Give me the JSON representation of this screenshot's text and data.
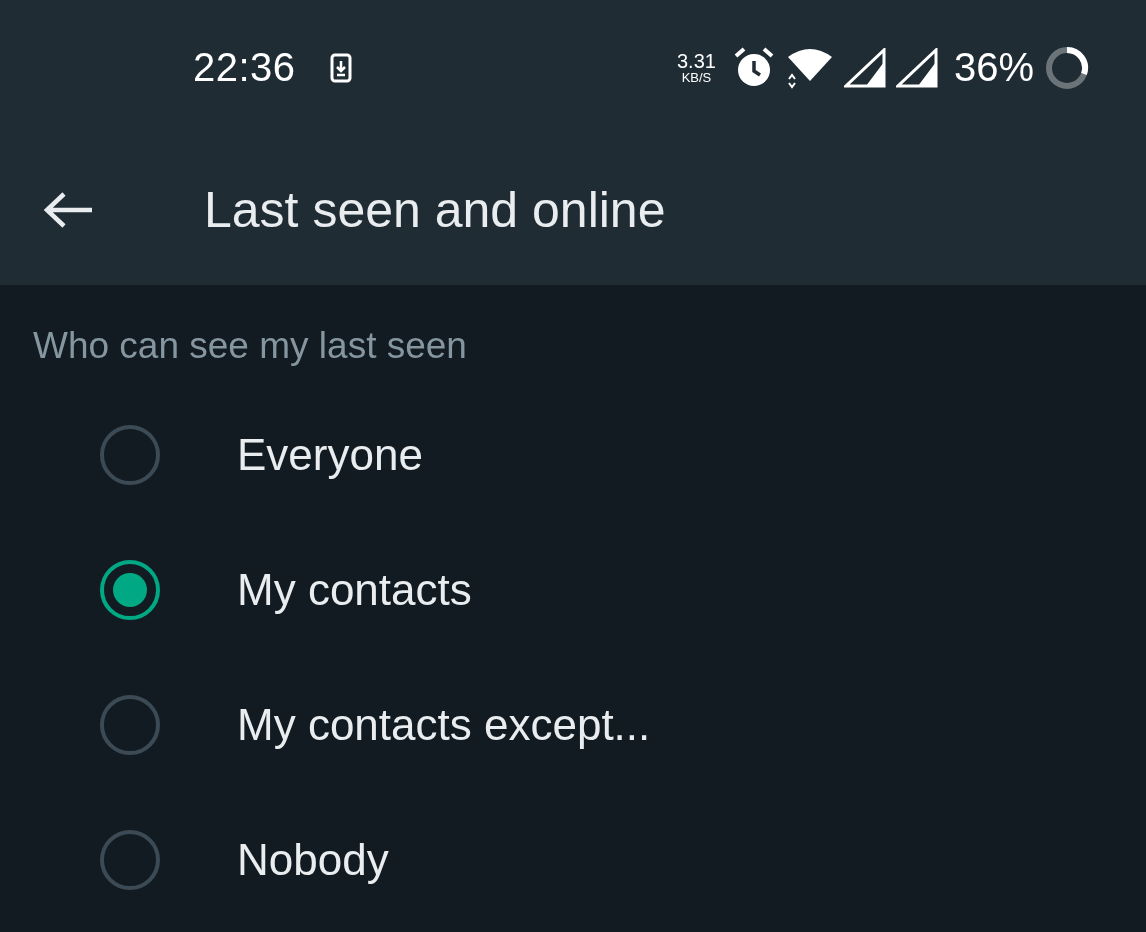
{
  "status_bar": {
    "time": "22:36",
    "net_speed_value": "3.31",
    "net_speed_unit": "KB/S",
    "battery": "36%"
  },
  "app_bar": {
    "title": "Last seen and online"
  },
  "section": {
    "header": "Who can see my last seen",
    "options": [
      {
        "label": "Everyone",
        "selected": false
      },
      {
        "label": "My contacts",
        "selected": true
      },
      {
        "label": "My contacts except...",
        "selected": false
      },
      {
        "label": "Nobody",
        "selected": false
      }
    ]
  }
}
